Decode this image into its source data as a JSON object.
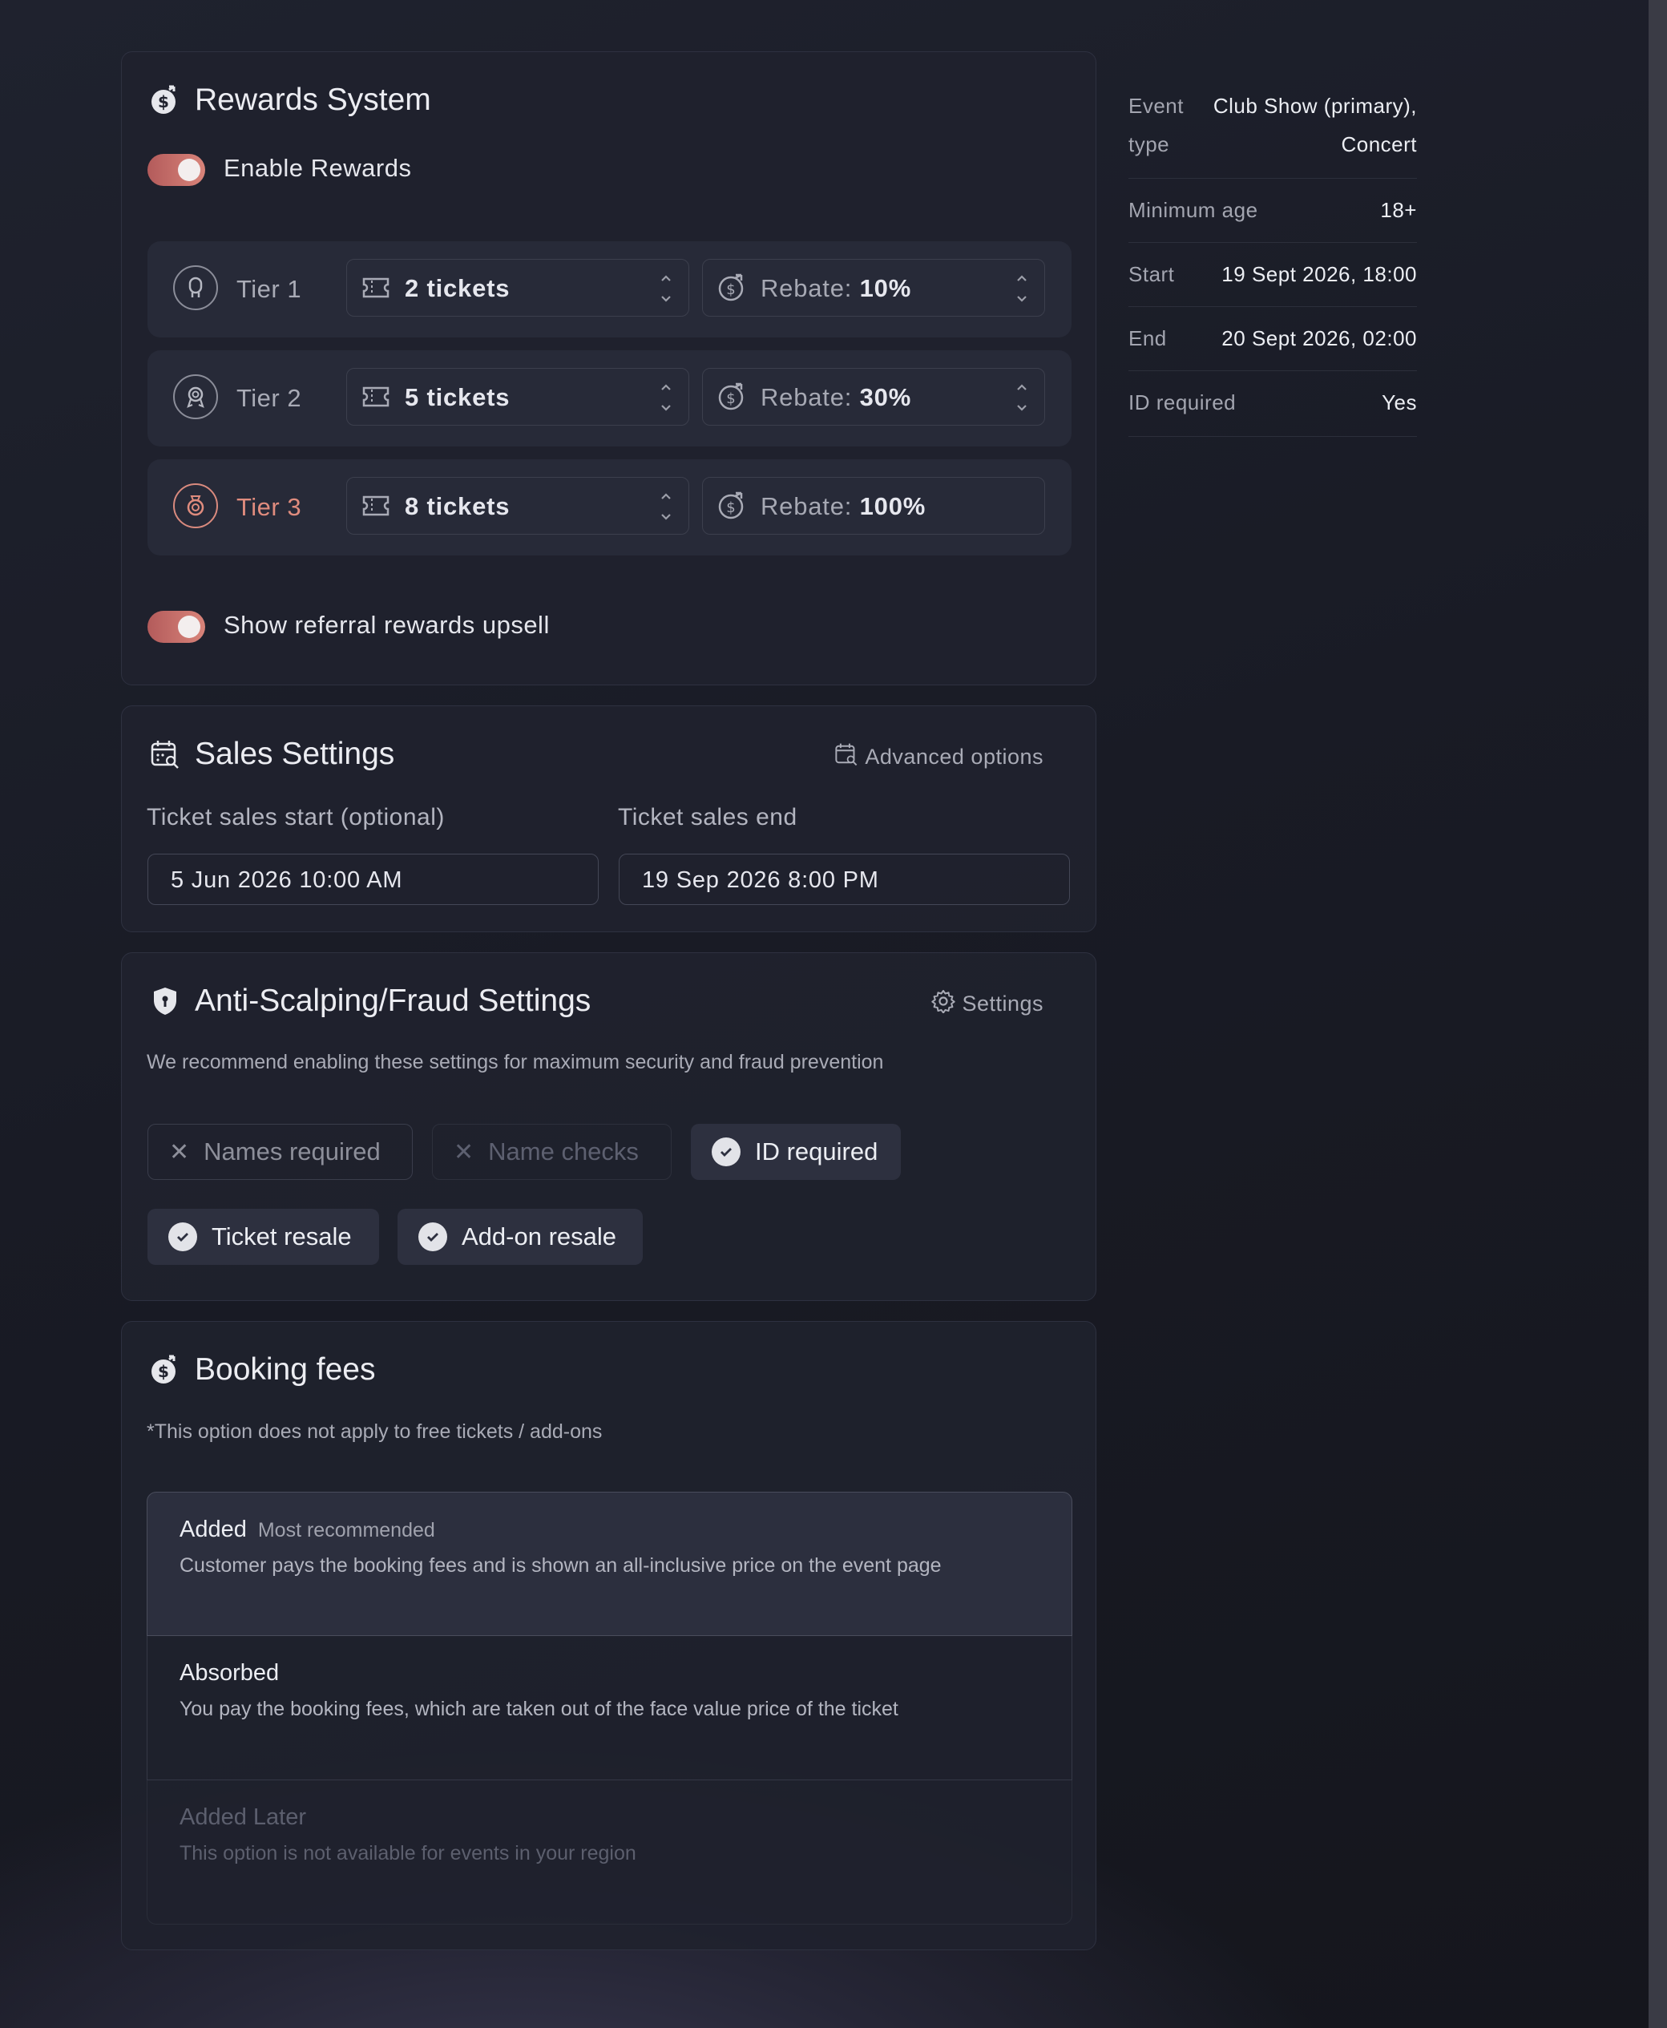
{
  "rewards": {
    "title": "Rewards System",
    "enable_label": "Enable Rewards",
    "tiers": [
      {
        "label": "Tier 1",
        "tickets": "2 tickets",
        "rebate_label": "Rebate:",
        "rebate_value": "10%"
      },
      {
        "label": "Tier 2",
        "tickets": "5 tickets",
        "rebate_label": "Rebate:",
        "rebate_value": "30%"
      },
      {
        "label": "Tier 3",
        "tickets": "8 tickets",
        "rebate_label": "Rebate:",
        "rebate_value": "100%"
      }
    ],
    "upsell_label": "Show referral rewards upsell"
  },
  "sales": {
    "title": "Sales Settings",
    "advanced_label": "Advanced options",
    "start_label": "Ticket sales start (optional)",
    "end_label": "Ticket sales end",
    "start_value": "5 Jun 2026 10:00 AM",
    "end_value": "19 Sep 2026 8:00 PM"
  },
  "fraud": {
    "title": "Anti-Scalping/Fraud Settings",
    "settings_label": "Settings",
    "description": "We recommend enabling these settings for maximum security and fraud prevention",
    "chips": [
      {
        "label": "Names required",
        "state": "off"
      },
      {
        "label": "Name checks",
        "state": "disabled"
      },
      {
        "label": "ID required",
        "state": "on"
      },
      {
        "label": "Ticket resale",
        "state": "on"
      },
      {
        "label": "Add-on resale",
        "state": "on"
      }
    ]
  },
  "fees": {
    "title": "Booking fees",
    "note": "*This option does not apply to free tickets / add-ons",
    "options": [
      {
        "name": "Added",
        "tag": "Most recommended",
        "desc": "Customer pays the booking fees and is shown an all-inclusive price on the event page"
      },
      {
        "name": "Absorbed",
        "tag": "",
        "desc": "You pay the booking fees, which are taken out of the face value price of the ticket"
      },
      {
        "name": "Added Later",
        "tag": "",
        "desc": "This option is not available for events in your region"
      }
    ]
  },
  "summary": [
    {
      "key1": "Event",
      "key2": "type",
      "val1": "Club Show (primary),",
      "val2": "Concert"
    },
    {
      "key1": "Minimum age",
      "val1": "18+"
    },
    {
      "key1": "Start",
      "val1": "19 Sept 2026, 18:00"
    },
    {
      "key1": "End",
      "val1": "20 Sept 2026, 02:00"
    },
    {
      "key1": "ID required",
      "val1": "Yes"
    }
  ],
  "colors": {
    "accent": "#d9847a",
    "tier3_accent": "#e08c7e"
  }
}
